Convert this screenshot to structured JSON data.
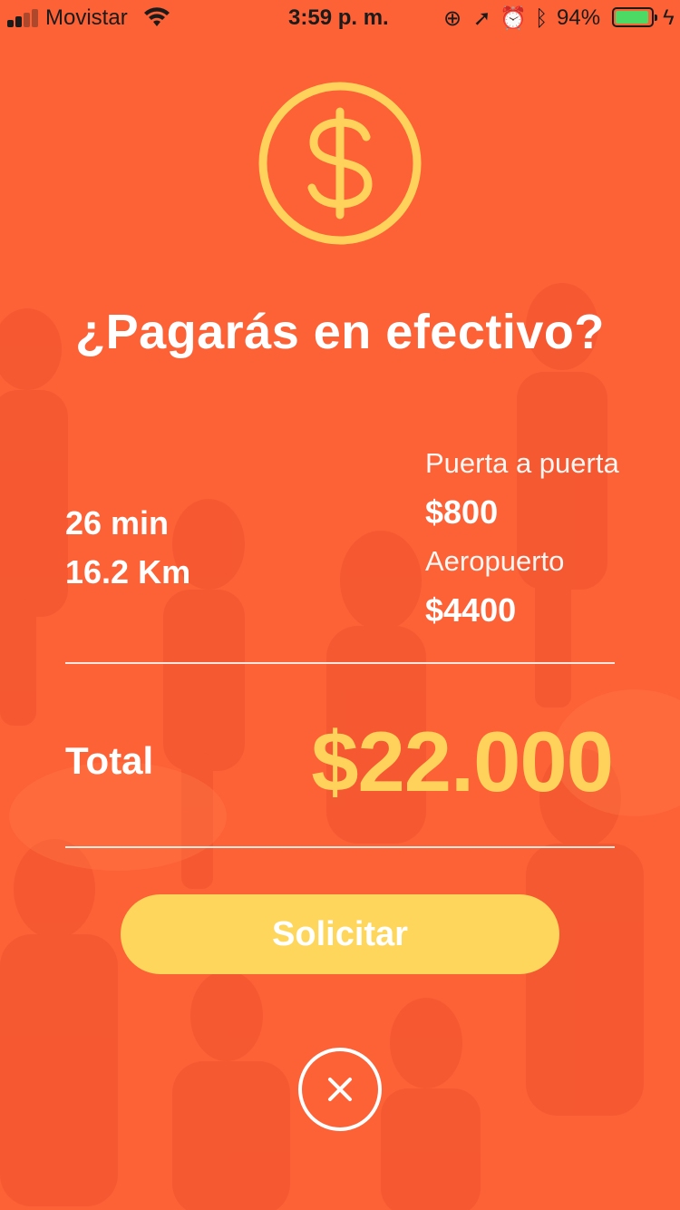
{
  "status_bar": {
    "carrier": "Movistar",
    "time": "3:59 p. m.",
    "icons": [
      "orientation-lock-icon",
      "location-icon",
      "alarm-icon",
      "bluetooth-icon"
    ],
    "battery_percent": "94%",
    "battery_level": 0.94
  },
  "header": {
    "icon": "dollar-coin-icon",
    "title": "¿Pagarás en efectivo?"
  },
  "trip": {
    "duration": "26 min",
    "distance": "16.2 Km"
  },
  "fares": [
    {
      "label": "Puerta a puerta",
      "value": "$800"
    },
    {
      "label": "Aeropuerto",
      "value": "$4400"
    }
  ],
  "total": {
    "label": "Total",
    "value": "$22.000"
  },
  "actions": {
    "request_label": "Solicitar",
    "close_icon": "close-icon"
  },
  "colors": {
    "background": "#fd6136",
    "accent": "#ffd25b",
    "button": "#ffd65c",
    "text": "#ffffff"
  }
}
